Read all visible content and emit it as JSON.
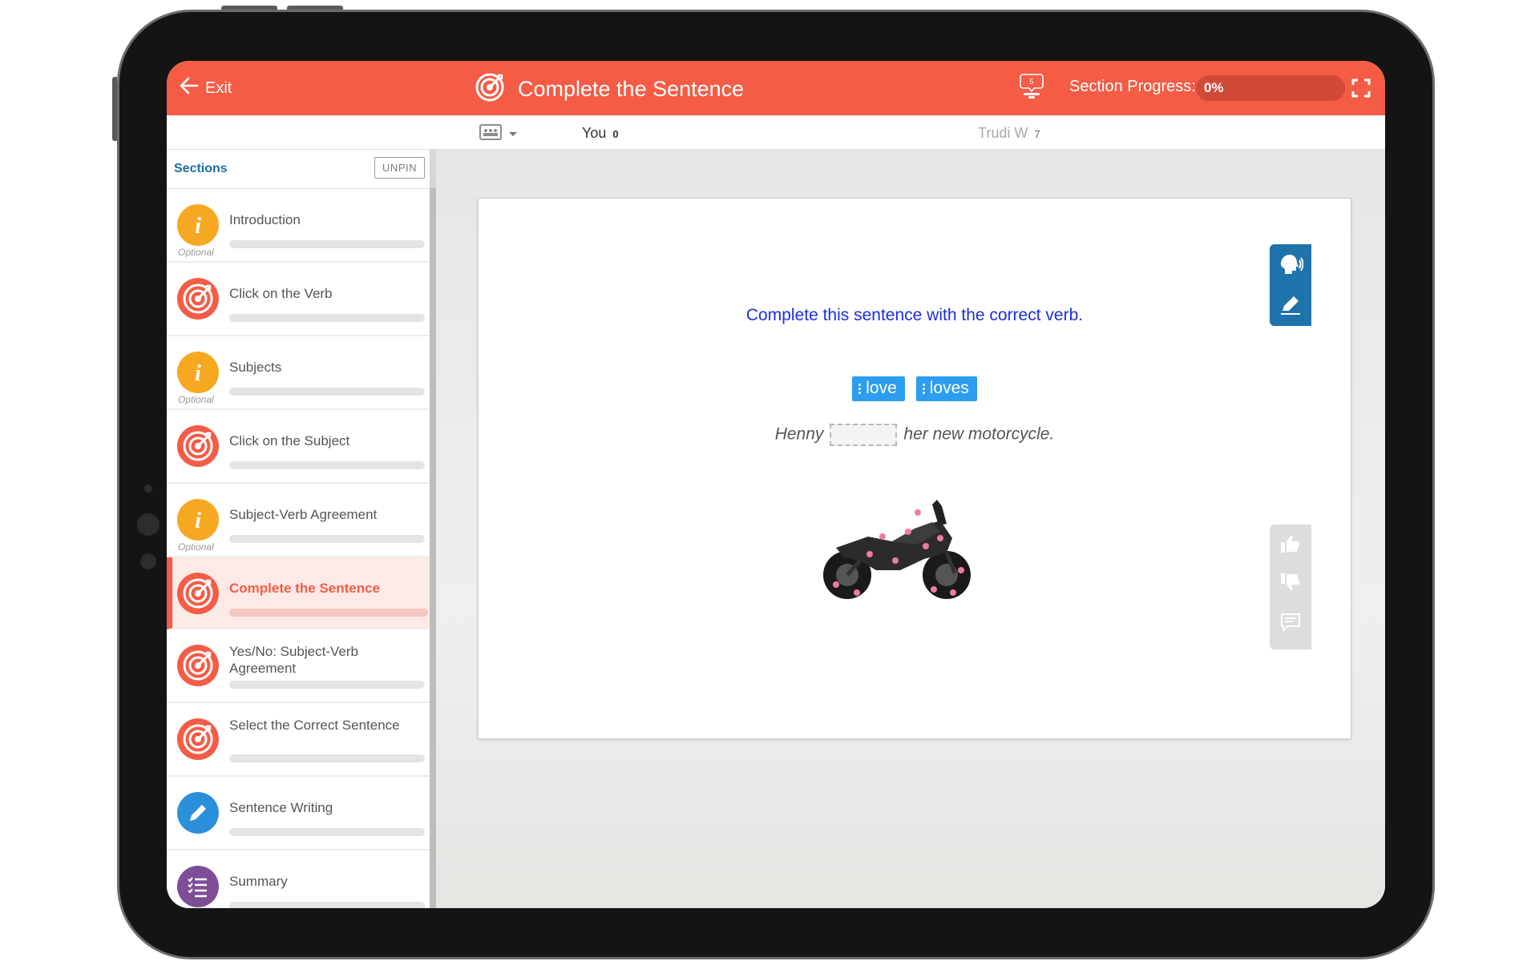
{
  "header": {
    "exit_label": "Exit",
    "title": "Complete the Sentence",
    "notification_count": "5",
    "progress_label": "Section Progress:",
    "progress_value": "0%",
    "progress_fraction": 0
  },
  "scores": {
    "you_label": "You",
    "you_score": "0",
    "opponent_name": "Trudi W",
    "opponent_score": "7"
  },
  "sidebar": {
    "title": "Sections",
    "unpin_label": "UNPIN",
    "optional_label": "Optional",
    "items": [
      {
        "label": "Introduction",
        "icon": "info-icon",
        "optional": true
      },
      {
        "label": "Click on the Verb",
        "icon": "target-icon",
        "optional": false
      },
      {
        "label": "Subjects",
        "icon": "info-icon",
        "optional": true
      },
      {
        "label": "Click on the Subject",
        "icon": "target-icon",
        "optional": false
      },
      {
        "label": "Subject-Verb Agreement",
        "icon": "info-icon",
        "optional": true
      },
      {
        "label": "Complete the Sentence",
        "icon": "target-icon",
        "optional": false,
        "active": true
      },
      {
        "label": "Yes/No: Subject-Verb Agreement",
        "icon": "target-icon",
        "optional": false
      },
      {
        "label": "Select the Correct Sentence",
        "icon": "target-icon",
        "optional": false
      },
      {
        "label": "Sentence Writing",
        "icon": "pencil-icon",
        "optional": false
      },
      {
        "label": "Summary",
        "icon": "list-icon",
        "optional": false
      }
    ]
  },
  "question": {
    "instruction": "Complete this sentence with the correct verb.",
    "choices": [
      "love",
      "loves"
    ],
    "sentence_before": "Henny",
    "sentence_after": "her new motorcycle."
  },
  "colors": {
    "accent": "#f45c46",
    "info": "#f7a823",
    "link": "#1c6ea4",
    "choice": "#2c9df0",
    "instruction": "#1b2ee0"
  }
}
